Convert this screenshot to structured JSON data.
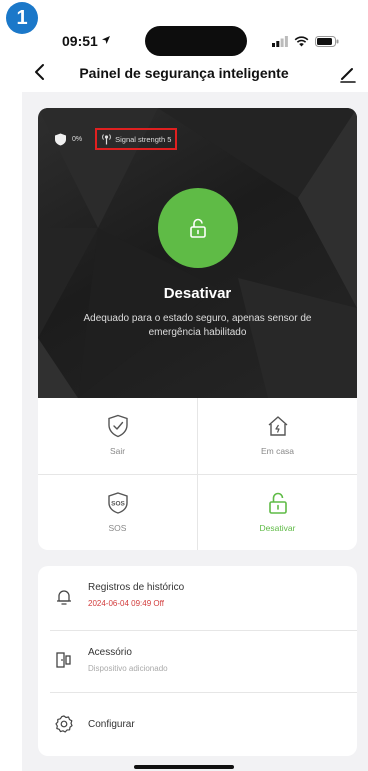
{
  "step_number": "1",
  "status_bar": {
    "time": "09:51"
  },
  "nav": {
    "title": "Painel de segurança inteligente",
    "back_icon": "chevron-left-icon",
    "edit_icon": "pencil-icon"
  },
  "hero": {
    "battery_percent": "0%",
    "signal_label": "Signal strength 5",
    "mode_title": "Desativar",
    "description": "Adequado para o estado seguro, apenas sensor de emergência habilitado",
    "accent_color": "#5fbb46"
  },
  "modes": [
    {
      "label": "Sair",
      "icon": "shield-check-icon",
      "active": false
    },
    {
      "label": "Em casa",
      "icon": "home-icon",
      "active": false
    },
    {
      "label": "SOS",
      "icon": "sos-icon",
      "active": false
    },
    {
      "label": "Desativar",
      "icon": "unlock-icon",
      "active": true
    }
  ],
  "menu": {
    "history": {
      "title": "Registros de histórico",
      "subtitle": "2024-06-04 09:49 Off",
      "subtitle_color": "#d23b3b"
    },
    "accessory": {
      "title": "Acessório",
      "subtitle": "Dispositivo adicionado"
    },
    "settings": {
      "title": "Configurar"
    }
  }
}
